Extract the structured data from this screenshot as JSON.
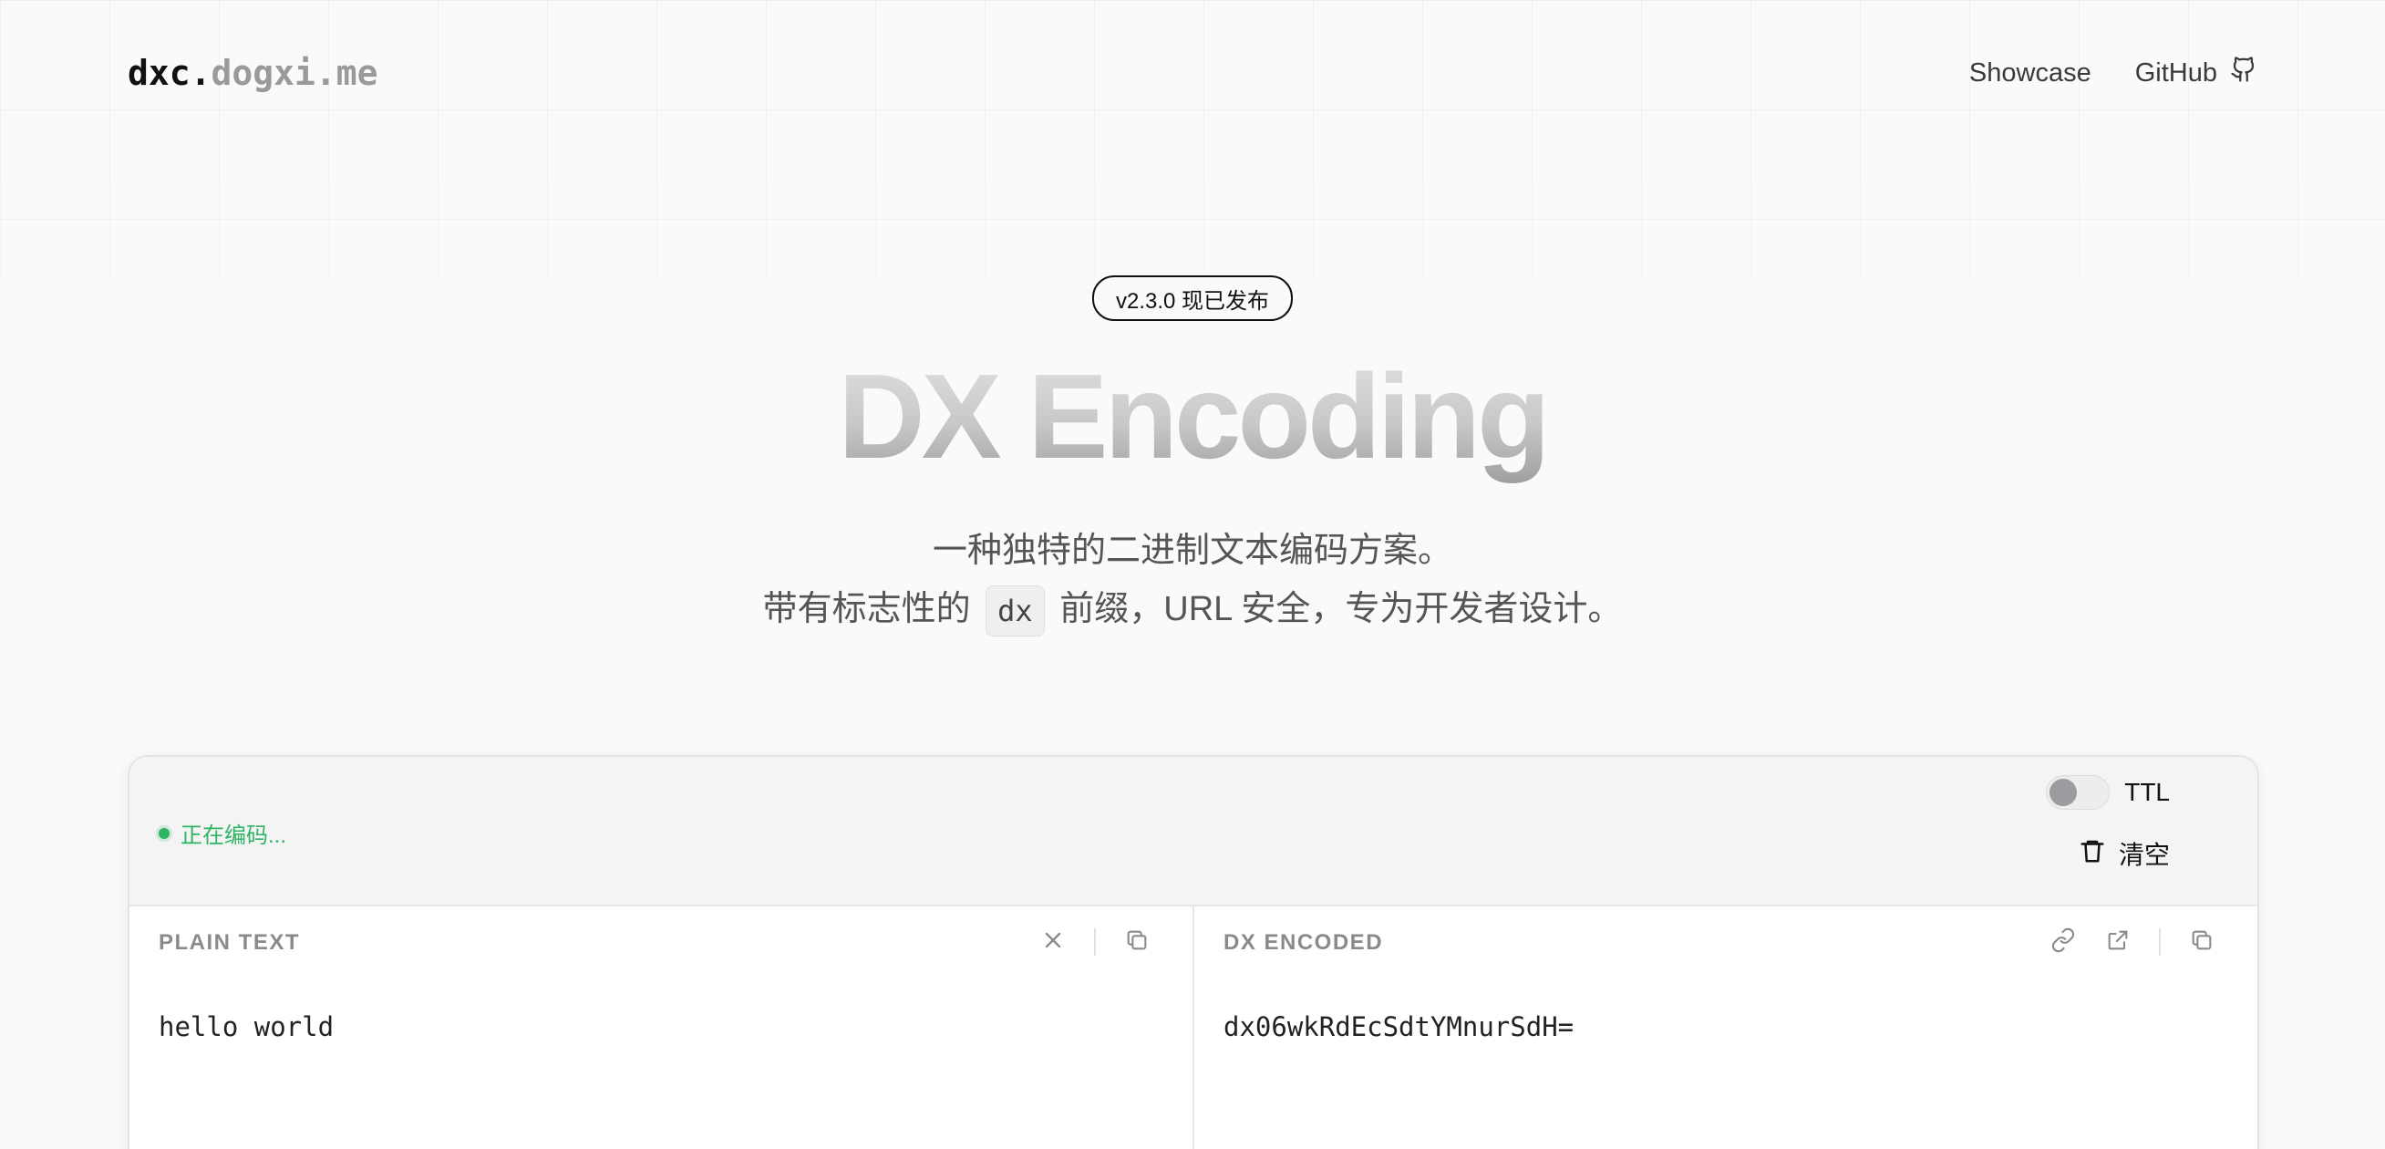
{
  "header": {
    "logo_main": "dxc.",
    "logo_domain": "dogxi.me",
    "nav": {
      "showcase": "Showcase",
      "github": "GitHub"
    }
  },
  "hero": {
    "badge": "v2.3.0 现已发布",
    "title": "DX Encoding",
    "subtitle_line1": "一种独特的二进制文本编码方案。",
    "subtitle_line2_before": "带有标志性的",
    "subtitle_code": "dx",
    "subtitle_line2_after": "前缀，URL 安全，专为开发者设计。"
  },
  "toolbar": {
    "status": "正在编码...",
    "ttl_label": "TTL",
    "ttl_enabled": false,
    "clear_label": "清空"
  },
  "panes": {
    "plain": {
      "label": "PLAIN TEXT",
      "value": "hello world"
    },
    "encoded": {
      "label": "DX ENCODED",
      "value": "dx06wkRdEcSdtYMnurSdH="
    }
  },
  "icons": {
    "github": "github-icon",
    "trash": "trash-icon",
    "clear_input": "x-icon",
    "copy": "copy-icon",
    "link": "link-icon",
    "external": "external-link-icon"
  },
  "colors": {
    "status_green": "#2fb463",
    "background": "#fafafa",
    "muted": "#9a9a9a"
  }
}
